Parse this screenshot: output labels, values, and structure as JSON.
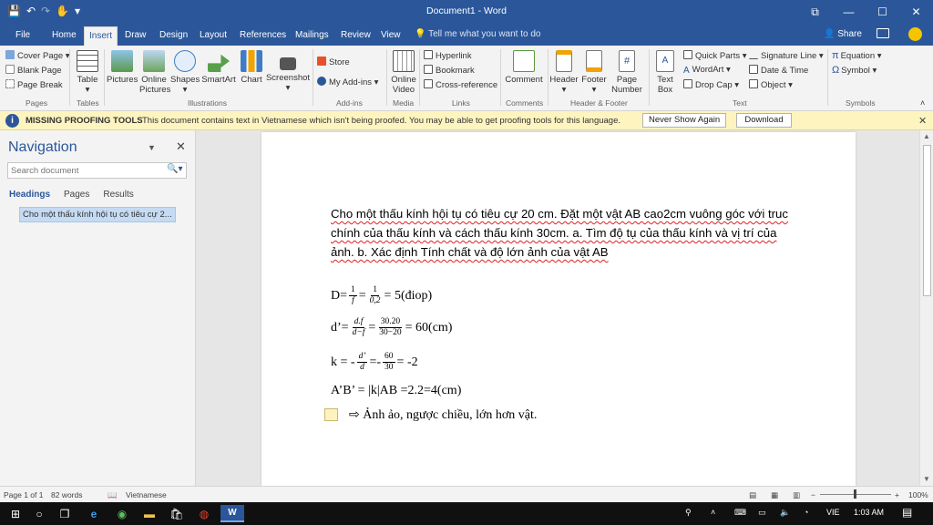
{
  "window": {
    "title": "Document1 - Word",
    "controls": [
      "⧉",
      "—",
      "☐",
      "✕"
    ]
  },
  "qat": {
    "save": "💾",
    "undo": "↶",
    "redo": "↷",
    "touch": "✋",
    "more": "▾"
  },
  "tabs": [
    "File",
    "Home",
    "Insert",
    "Draw",
    "Design",
    "Layout",
    "References",
    "Mailings",
    "Review",
    "View"
  ],
  "tell_me": "Tell me what you want to do",
  "share": "Share",
  "ribbon": {
    "pages": {
      "cover_page": "Cover Page",
      "blank_page": "Blank Page",
      "page_break": "Page Break",
      "label": "Pages"
    },
    "tables": {
      "table": "Table",
      "label": "Tables"
    },
    "illustrations": {
      "pictures": "Pictures",
      "online_pictures_1": "Online",
      "online_pictures_2": "Pictures",
      "shapes": "Shapes",
      "smartart": "SmartArt",
      "chart": "Chart",
      "screenshot": "Screenshot",
      "label": "Illustrations"
    },
    "addins": {
      "store": "Store",
      "my_addins": "My Add-ins",
      "label": "Add-ins"
    },
    "media": {
      "online_video_1": "Online",
      "online_video_2": "Video",
      "label": "Media"
    },
    "links": {
      "hyperlink": "Hyperlink",
      "bookmark": "Bookmark",
      "cross_reference": "Cross-reference",
      "label": "Links"
    },
    "comments": {
      "comment": "Comment",
      "label": "Comments"
    },
    "header_footer": {
      "header": "Header",
      "footer": "Footer",
      "page_number_1": "Page",
      "page_number_2": "Number",
      "label": "Header & Footer"
    },
    "text": {
      "text_box_1": "Text",
      "text_box_2": "Box",
      "quick_parts": "Quick Parts",
      "wordart": "WordArt",
      "drop_cap": "Drop Cap",
      "signature_line": "Signature Line",
      "date_time": "Date & Time",
      "object": "Object",
      "label": "Text"
    },
    "symbols": {
      "equation": "Equation",
      "symbol": "Symbol",
      "label": "Symbols"
    }
  },
  "message_bar": {
    "title": "MISSING PROOFING TOOLS",
    "text": "This document contains text in Vietnamese which isn't being proofed. You may be able to get proofing tools for this language.",
    "never_show": "Never Show Again",
    "download": "Download"
  },
  "navigation": {
    "title": "Navigation",
    "search_placeholder": "Search document",
    "tabs": [
      "Headings",
      "Pages",
      "Results"
    ],
    "heading_item": "Cho một thấu kính hội tụ có tiêu cự 2..."
  },
  "document": {
    "problem": "Cho một thấu kính hội tụ có tiêu cự 20 cm. Đặt một vật AB cao2cm vuông góc với truc chính của thấu kính và cách thấu kính 30cm. a. Tìm độ tụ của thấu kính và vị trí của ảnh. b. Xác định Tính chất và độ lớn ảnh của vật AB",
    "eq1": {
      "lhs": "D=",
      "f1_num": "1",
      "f1_den": "f",
      "eq": "=",
      "f2_num": "1",
      "f2_den": "0,2",
      "rhs": "= 5(điop)"
    },
    "eq2": {
      "lhs": "d’=",
      "f1_num": "d.f",
      "f1_den": "d−f",
      "eq": "=",
      "f2_num": "30.20",
      "f2_den": "30−20",
      "rhs": "= 60(cm)"
    },
    "eq3": {
      "lhs": "k = -",
      "f1_num": "d’",
      "f1_den": "d",
      "eq": "=-",
      "f2_num": "60",
      "f2_den": "30",
      "rhs": "= -2"
    },
    "eq4": {
      "text": "A’B’ = |k|AB  =2.2=4(cm)"
    },
    "conclusion": "⇨  Ảnh ảo, ngược chiều, lớn hơn vật."
  },
  "status": {
    "page": "Page 1 of 1",
    "words": "82 words",
    "language": "Vietnamese",
    "zoom": "100%",
    "zoom_minus": "−",
    "zoom_plus": "+"
  },
  "taskbar": {
    "lang": "VIE",
    "time": "1:03 AM"
  }
}
